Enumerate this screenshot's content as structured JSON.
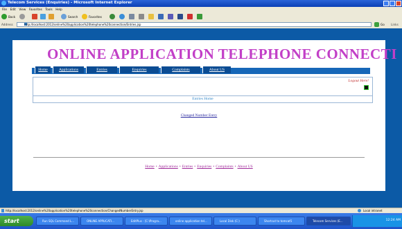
{
  "window": {
    "title": "Telecom Services (Enquiries) - Microsoft Internet Explorer"
  },
  "menu": [
    "File",
    "Edit",
    "View",
    "Favorites",
    "Tools",
    "Help"
  ],
  "toolbar": {
    "back": "Back",
    "search": "Search",
    "favorites": "Favorites"
  },
  "address": {
    "label": "Address",
    "url": "http://localhost:2012/online%20application%20telephone%20connection/Entries.jsp",
    "go": "Go",
    "links": "Links"
  },
  "page": {
    "title": "ONLINE APPLICATION TELEPHONE CONNECTI",
    "nav": [
      "Home",
      "Applications",
      "Entries",
      "Enquiries",
      "Complaints",
      "About US"
    ],
    "logout": "Logout Here!",
    "section_title": "Entries Home",
    "changed_link": "Changed Number Entry",
    "footer": [
      "Home",
      "Applications",
      "Entries",
      "Enquiries",
      "Complaints",
      "About US"
    ]
  },
  "status": {
    "text": "http://localhost:2012/online%20application%20telephone%20connection/ChangedNumberEntry.jsp",
    "zone": "Local intranet"
  },
  "taskbar": {
    "start": "start",
    "tasks": [
      "Run SQL Command L...",
      "ONLINE APPLICATI...",
      "EditPlus - [C:\\Progra...",
      "online application tel...",
      "Local Disk (C:)",
      "Shortcut to tomcat5",
      "Telecom Services (E..."
    ],
    "clock": "12:24 AM"
  }
}
